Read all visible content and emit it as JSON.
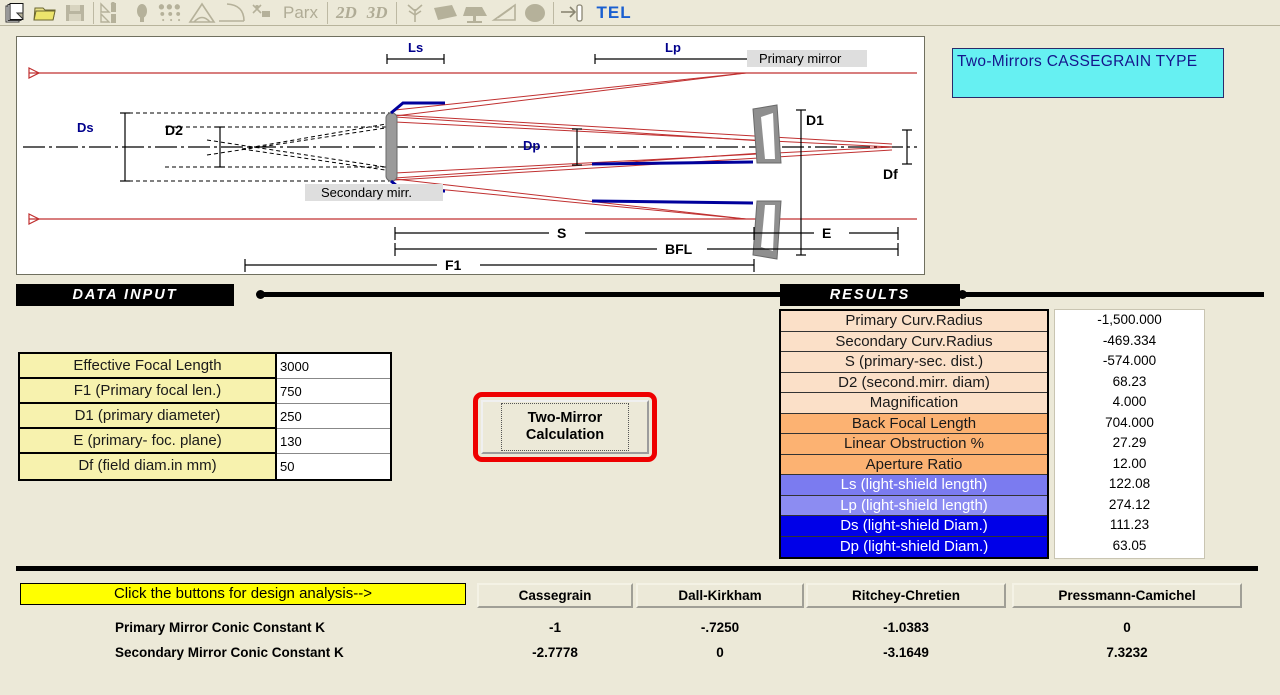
{
  "toolbar": {
    "icons": [
      {
        "name": "new-document-icon",
        "glyph": "new"
      },
      {
        "name": "open-folder-icon",
        "glyph": "folder"
      },
      {
        "name": "save-disk-icon",
        "glyph": "save"
      },
      {
        "name": "chart-tools-icon",
        "glyph": "charts"
      },
      {
        "name": "bulb-icon",
        "glyph": "bulb"
      },
      {
        "name": "spots-icon",
        "glyph": "spots"
      },
      {
        "name": "triangle-icon",
        "glyph": "triangle"
      },
      {
        "name": "arc-icon",
        "glyph": "arc"
      },
      {
        "name": "star-cut-icon",
        "glyph": "starcut"
      }
    ],
    "parx_label": "Parx",
    "mode_2d": "2D",
    "mode_3d": "3D",
    "icons2": [
      {
        "name": "plant-icon",
        "glyph": "plant"
      },
      {
        "name": "mirror-blank-icon",
        "glyph": "blank"
      },
      {
        "name": "mirror-mount-icon",
        "glyph": "mount"
      },
      {
        "name": "wedge-icon",
        "glyph": "wedge"
      },
      {
        "name": "disc-icon",
        "glyph": "disc"
      },
      {
        "name": "focus-icon",
        "glyph": "focus"
      }
    ],
    "tel_label": "TEL"
  },
  "title_box": {
    "text": "Two-Mirrors  CASSEGRAIN  TYPE"
  },
  "diagram": {
    "labels": {
      "ls": "Ls",
      "lp": "Lp",
      "ds": "Ds",
      "d2": "D2",
      "dp": "Dp",
      "d1": "D1",
      "df": "Df",
      "s": "S",
      "e": "E",
      "bfl": "BFL",
      "f1": "F1",
      "primary_mirror": "Primary mirror",
      "secondary_mirror": "Secondary mirr."
    }
  },
  "sections": {
    "data_input": "DATA  INPUT",
    "results": "RESULTS"
  },
  "input": {
    "rows": [
      {
        "label": "Effective Focal Length",
        "value": "3000"
      },
      {
        "label": "F1 (Primary focal len.)",
        "value": "750"
      },
      {
        "label": "D1 (primary diameter)",
        "value": "250"
      },
      {
        "label": "E (primary- foc. plane)",
        "value": "130"
      },
      {
        "label": "Df (field  diam.in mm)",
        "value": "50"
      }
    ]
  },
  "calc_button": {
    "line1": "Two-Mirror",
    "line2": "Calculation"
  },
  "results": {
    "rows": [
      {
        "label": "Primary Curv.Radius",
        "value": "-1,500.000",
        "bg": "#fbe0c8",
        "fg": "#1a1a1a"
      },
      {
        "label": "Secondary Curv.Radius",
        "value": "-469.334",
        "bg": "#fbe0c8",
        "fg": "#1a1a1a"
      },
      {
        "label": "S (primary-sec.  dist.)",
        "value": "-574.000",
        "bg": "#fbe0c8",
        "fg": "#1a1a1a"
      },
      {
        "label": "D2 (second.mirr. diam)",
        "value": "68.23",
        "bg": "#fbe0c8",
        "fg": "#1a1a1a"
      },
      {
        "label": "Magnification",
        "value": "4.000",
        "bg": "#fbe0c8",
        "fg": "#1a1a1a"
      },
      {
        "label": "Back Focal Length",
        "value": "704.000",
        "bg": "#fcb272",
        "fg": "#1a1a1a"
      },
      {
        "label": "Linear Obstruction %",
        "value": "27.29",
        "bg": "#fcb272",
        "fg": "#1a1a1a"
      },
      {
        "label": "Aperture Ratio",
        "value": "12.00",
        "bg": "#fcb272",
        "fg": "#1a1a1a"
      },
      {
        "label": "Ls (light-shield length)",
        "value": "122.08",
        "bg": "#7b7bf0",
        "fg": "#ffffff"
      },
      {
        "label": "Lp (light-shield length)",
        "value": "274.12",
        "bg": "#8c8cf2",
        "fg": "#ffffff"
      },
      {
        "label": "Ds (light-shield Diam.)",
        "value": "111.23",
        "bg": "#0000e8",
        "fg": "#ffffff"
      },
      {
        "label": "Dp (light-shield Diam.)",
        "value": "63.05",
        "bg": "#0000e8",
        "fg": "#ffffff"
      }
    ]
  },
  "analysis": {
    "banner": "Click the buttons for design analysis-->",
    "buttons": [
      {
        "label": "Cassegrain"
      },
      {
        "label": "Dall-Kirkham"
      },
      {
        "label": "Ritchey-Chretien"
      },
      {
        "label": "Pressmann-Camichel"
      }
    ],
    "row_labels": [
      "Primary    Mirror Conic Constant  K",
      "Secondary Mirror Conic Constant  K"
    ],
    "primary_values": [
      "-1",
      "-.7250",
      "-1.0383",
      "0"
    ],
    "secondary_values": [
      "-2.7778",
      "0",
      "-3.1649",
      "7.3232"
    ]
  },
  "colors": {
    "app_bg": "#ece9d8",
    "title_box_bg": "#66f0f2",
    "title_box_fg": "#15158c",
    "banner_bg": "#ffff00",
    "button_red": "#ee0000",
    "ray_red": "#c03030",
    "mirror_blue": "#00009c"
  }
}
